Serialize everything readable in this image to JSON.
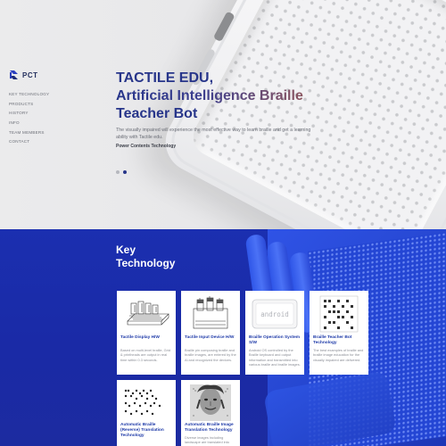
{
  "brand": {
    "logo_text": "PCT"
  },
  "nav": {
    "items": [
      "KEY TECHNOLOGY",
      "PRODUCTS",
      "HISTORY",
      "INFO",
      "TEAM MEMBERS",
      "CONTACT"
    ]
  },
  "hero": {
    "title_line1": "TACTILE EDU,",
    "title_line2": "Artificial Intelligence Braille",
    "title_line3": "Teacher Bot",
    "description": "The visually impaired will experience the most effective way to learn braille and get a learning ability with Tactile edu.",
    "power": "Power Contents Technology",
    "slides": 2,
    "active_slide": 2
  },
  "key_technology": {
    "title_line1": "Key",
    "title_line2": "Technology",
    "cards": [
      {
        "title": "Tactile Display H/W",
        "desc": "Based on multi-level braille, Grid & printheads are output in real time within 0.3 seconds.",
        "icon": "tactile-display-device-icon"
      },
      {
        "title": "Tactile Input Device H/W",
        "desc": "Braille pin composing braille and braille images, are entered by the Al and recognized the devices.",
        "icon": "tactile-input-device-icon"
      },
      {
        "title": "Braille Operation System S/W",
        "desc": "Android OS controlled by the Braille keyboard and output information and transmitted into various braille and braille images.",
        "icon": "android-screen-icon"
      },
      {
        "title": "Braille Teacher Bot Technology",
        "desc": "The best examples of braille and braille image education for the visually impaired are delivered.",
        "icon": "braille-grid-icon"
      },
      {
        "title": "Automatic Braille (Reverse) Translation Technology",
        "desc": "",
        "icon": "braille-dots-icon"
      },
      {
        "title": "Automatic Braille Image Translation Technology",
        "desc": "Diverse images including landscape are translated into tactile",
        "icon": "portrait-image-icon"
      }
    ]
  },
  "colors": {
    "accent": "#27358a",
    "section_blue": "#1b2fb0",
    "card_title": "#1e3aa8"
  }
}
